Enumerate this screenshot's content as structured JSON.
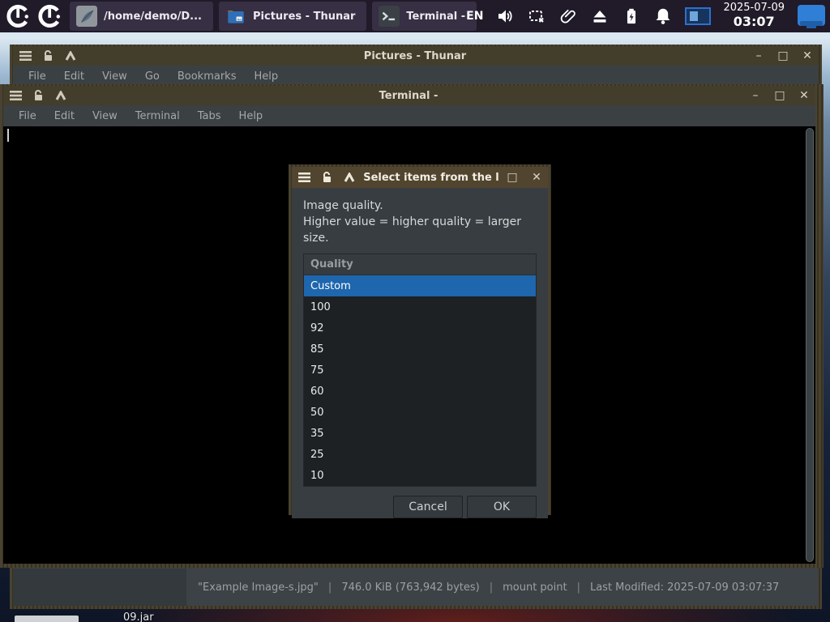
{
  "colors": {
    "selection_blue": "#1e66ad",
    "titlebar_active": "#51452f",
    "titlebar_inactive": "#433d2c",
    "panel_bg": "#201a29",
    "accent_blue": "#2f7fd6"
  },
  "panel": {
    "taskbar_items": [
      {
        "label": "/home/demo/D..."
      },
      {
        "label": "Pictures - Thunar"
      },
      {
        "label": "Terminal -"
      }
    ],
    "keyboard_layout": "EN",
    "clock_date": "2025-07-09",
    "clock_time": "03:07"
  },
  "thunar_window": {
    "title": "Pictures - Thunar",
    "menu": [
      "File",
      "Edit",
      "View",
      "Go",
      "Bookmarks",
      "Help"
    ],
    "status_segments": [
      "\"Example Image-s.jpg\"",
      "746.0 KiB (763,942 bytes)",
      "mount point",
      "Last Modified: 2025-07-09 03:07:37"
    ],
    "status_separator": "|"
  },
  "terminal_window": {
    "title": "Terminal -",
    "menu": [
      "File",
      "Edit",
      "View",
      "Terminal",
      "Tabs",
      "Help"
    ]
  },
  "dialog": {
    "title": "Select items from the l",
    "message_line1": "Image quality.",
    "message_line2": "Higher value = higher quality = larger size.",
    "list_header": "Quality",
    "list_items": [
      "Custom",
      "100",
      "92",
      "85",
      "75",
      "60",
      "50",
      "35",
      "25",
      "10"
    ],
    "selected_item": "Custom",
    "cancel_label": "Cancel",
    "ok_label": "OK"
  },
  "desktop": {
    "partial_icon_label": "09.jar"
  }
}
